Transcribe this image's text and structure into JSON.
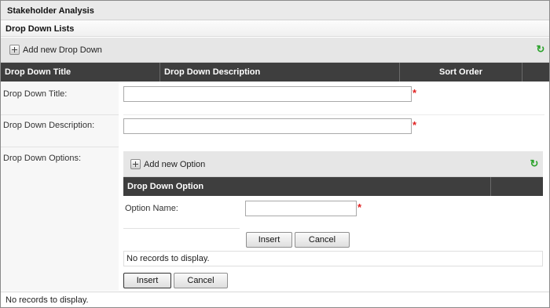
{
  "window": {
    "title": "Stakeholder Analysis"
  },
  "section": {
    "title": "Drop Down Lists"
  },
  "toolbar": {
    "add_label": "Add new Drop Down",
    "plus_icon": "plus-box-icon",
    "refresh_icon": "refresh-icon"
  },
  "grid": {
    "columns": [
      "Drop Down Title",
      "Drop Down Description",
      "Sort Order",
      ""
    ]
  },
  "form": {
    "title_label": "Drop Down Title:",
    "title_value": "",
    "description_label": "Drop Down Description:",
    "description_value": "",
    "options_label": "Drop Down Options:",
    "required_mark": "*"
  },
  "options": {
    "add_label": "Add new Option",
    "columns": [
      "Drop Down Option",
      ""
    ],
    "option_name_label": "Option Name:",
    "option_name_value": "",
    "insert_label": "Insert",
    "cancel_label": "Cancel",
    "no_records": "No records to display."
  },
  "footer": {
    "insert_label": "Insert",
    "cancel_label": "Cancel",
    "no_records": "No records to display."
  },
  "colors": {
    "header_bg": "#3e3e3e",
    "required": "#e02020",
    "refresh": "#2aa22a"
  }
}
